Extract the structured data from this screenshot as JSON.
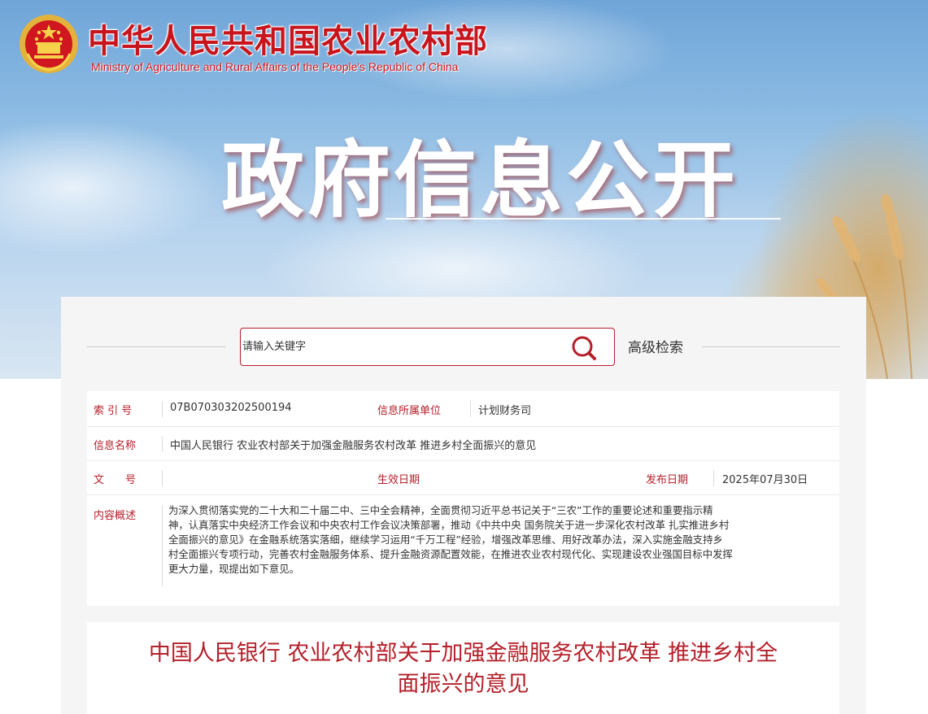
{
  "header": {
    "ministry_cn": "中华人民共和国农业农村部",
    "ministry_en": "Ministry of Agriculture and Rural Affairs of the People's Republic of China",
    "hero_title": "政府信息公开"
  },
  "search": {
    "placeholder": "请输入关键字",
    "advanced_label": "高级检索",
    "icon": "search-icon"
  },
  "info": {
    "index_label": "索 引 号",
    "index_value": "07B070303202500194",
    "unit_label": "信息所属单位",
    "unit_value": "计划财务司",
    "name_label": "信息名称",
    "name_value": "中国人民银行 农业农村部关于加强金融服务农村改革 推进乡村全面振兴的意见",
    "doc_no_label": "文　　号",
    "doc_no_value": "",
    "effective_label": "生效日期",
    "effective_value": "",
    "publish_label": "发布日期",
    "publish_value": "2025年07月30日",
    "summary_label": "内容概述",
    "summary_lines": [
      "为深入贯彻落实党的二十大和二十届二中、三中全会精神，全面贯彻习近平总书记关于“三农”工作的重要论述和重要指示精",
      "神，认真落实中央经济工作会议和中央农村工作会议决策部署，推动《中共中央 国务院关于进一步深化农村改革 扎实推进乡村",
      "全面振兴的意见》在金融系统落实落细，继续学习运用“千万工程”经验，增强改革思维、用好改革办法，深入实施金融支持乡",
      "村全面振兴专项行动，完善农村金融服务体系、提升金融资源配置效能，在推进农业农村现代化、实现建设农业强国目标中发挥",
      "更大力量，现提出如下意见。"
    ]
  },
  "article": {
    "title_line1": "中国人民银行 农业农村部关于加强金融服务农村改革 推进乡村全",
    "title_line2": "面振兴的意见"
  },
  "colors": {
    "brand_red": "#c8151d",
    "label_red": "#b4202a",
    "sky_blue": "#8cbbe3"
  }
}
